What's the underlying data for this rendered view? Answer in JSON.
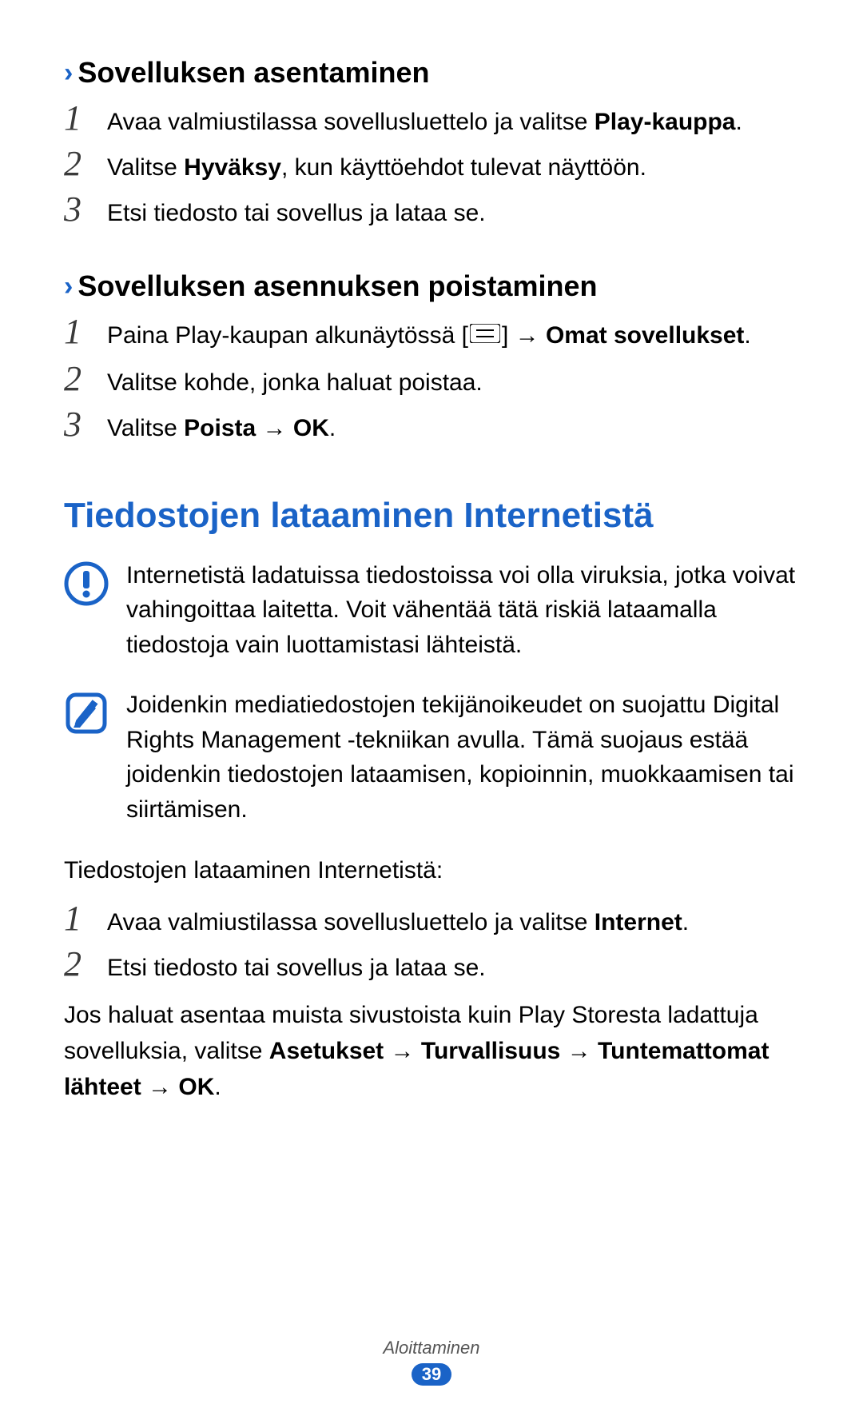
{
  "section1": {
    "heading": "Sovelluksen asentaminen",
    "items": [
      {
        "num": "1",
        "pre": "Avaa valmiustilassa sovellusluettelo ja valitse ",
        "bold_end": "Play-kauppa",
        "post": "."
      },
      {
        "num": "2",
        "pre": "Valitse ",
        "bold_mid": "Hyväksy",
        "post": ", kun käyttöehdot tulevat näyttöön."
      },
      {
        "num": "3",
        "pre": "Etsi tiedosto tai sovellus ja lataa se."
      }
    ]
  },
  "section2": {
    "heading": "Sovelluksen asennuksen poistaminen",
    "items": [
      {
        "num": "1",
        "pre": "Paina Play-kaupan alkunäytössä [",
        "post_icon": "] → ",
        "bold_end": "Omat sovellukset",
        "post": "."
      },
      {
        "num": "2",
        "pre": "Valitse kohde, jonka haluat poistaa."
      },
      {
        "num": "3",
        "pre": "Valitse ",
        "bold_mid": "Poista",
        "arrow": " → ",
        "bold_end": "OK",
        "post": "."
      }
    ]
  },
  "h1": "Tiedostojen lataaminen Internetistä",
  "callout_warning": "Internetistä ladatuissa tiedostoissa voi olla viruksia, jotka voivat vahingoittaa laitetta. Voit vähentää tätä riskiä lataamalla tiedostoja vain luottamistasi lähteistä.",
  "callout_note": "Joidenkin mediatiedostojen tekijänoikeudet on suojattu Digital Rights Management -tekniikan avulla. Tämä suojaus estää joidenkin tiedostojen lataamisen, kopioinnin, muokkaamisen tai siirtämisen.",
  "section3_intro": "Tiedostojen lataaminen Internetistä:",
  "section3": {
    "items": [
      {
        "num": "1",
        "pre": "Avaa valmiustilassa sovellusluettelo ja valitse ",
        "bold_end": "Internet",
        "post": "."
      },
      {
        "num": "2",
        "pre": "Etsi tiedosto tai sovellus ja lataa se."
      }
    ]
  },
  "outro": {
    "pre": "Jos haluat asentaa muista sivustoista kuin Play Storesta ladattuja sovelluksia, valitse ",
    "b1": "Asetukset",
    "a1": " → ",
    "b2": "Turvallisuus",
    "a2": " → ",
    "b3": "Tuntemattomat lähteet",
    "a3": " → ",
    "b4": "OK",
    "post": "."
  },
  "footer": {
    "label": "Aloittaminen",
    "page": "39"
  }
}
